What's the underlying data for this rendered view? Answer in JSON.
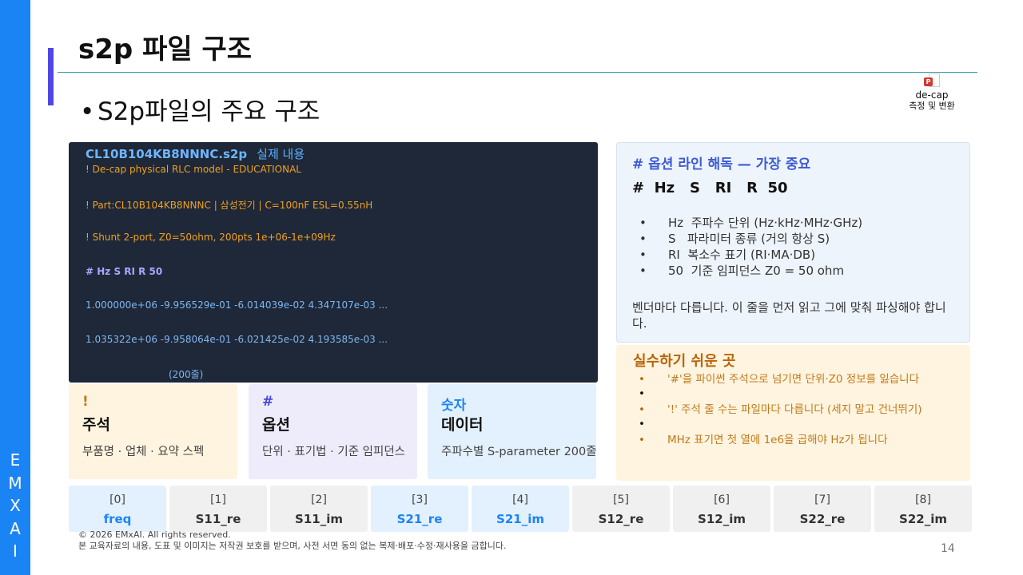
{
  "brand": {
    "letters": [
      "E",
      "M",
      "X",
      "A",
      "I"
    ],
    "color": "#1b84f5"
  },
  "title": "s2p 파일 구조",
  "bullet": "S2p파일의 주요 구조",
  "deck_icon": {
    "name": "de-cap",
    "sub": "측정 및 변환"
  },
  "code": {
    "filename": "CL10B104KB8NNNC.s2p",
    "caption": "실제 내용",
    "lines": {
      "c1": "! De-cap physical RLC model - EDUCATIONAL",
      "c2": "! Part:CL10B104KB8NNNC | 삼성전기 | C=100nF ESL=0.55nH",
      "c3": "! Shunt 2-port, Z0=50ohm, 200pts 1e+06-1e+09Hz",
      "opt": "# Hz S RI R 50",
      "d1": "1.000000e+06 -9.956529e-01 -6.014039e-02 4.347107e-03 ...",
      "d2": "1.035322e+06 -9.958064e-01 -6.021425e-02 4.193585e-03 ...",
      "count": "(200줄)"
    }
  },
  "options": {
    "title": "# 옵션 라인 해독 — 가장 중요",
    "line": "#  Hz   S   RI   R  50",
    "items": [
      {
        "key": "Hz",
        "text": "주파수 단위 (Hz·kHz·MHz·GHz)"
      },
      {
        "key": "S",
        "text": "파라미터 종류 (거의 항상 S)"
      },
      {
        "key": "RI",
        "text": "복소수 표기 (RI·MA·DB)"
      },
      {
        "key": "50",
        "text": "기준 임피던스 Z0 = 50 ohm"
      }
    ],
    "note": "벤더마다 다릅니다. 이 줄을 먼저 읽고 그에 맞춰 파싱해야 합니다."
  },
  "warnings": {
    "title": "실수하기 쉬운 곳",
    "items": [
      "'#'을 파이썬 주석으로 넘기면 단위·Z0 정보를 잃습니다",
      "",
      "'!' 주석 줄 수는 파일마다 다릅니다 (세지 말고 건너뛰기)",
      "",
      "MHz 표기면 첫 열에 1e6을 곱해야 Hz가 됩니다"
    ]
  },
  "cards": [
    {
      "symbol": "!",
      "label": "주석",
      "desc": "부품명 · 업체 · 요약 스펙"
    },
    {
      "symbol": "#",
      "label": "옵션",
      "desc": "단위 · 표기법 · 기준 임피던스"
    },
    {
      "symbol": "숫자",
      "label": "데이터",
      "desc": "주파수별 S-parameter 200줄"
    }
  ],
  "columns": [
    {
      "index": "[0]",
      "name": "freq",
      "highlight": true
    },
    {
      "index": "[1]",
      "name": "S11_re",
      "highlight": false
    },
    {
      "index": "[2]",
      "name": "S11_im",
      "highlight": false
    },
    {
      "index": "[3]",
      "name": "S21_re",
      "highlight": true
    },
    {
      "index": "[4]",
      "name": "S21_im",
      "highlight": true
    },
    {
      "index": "[5]",
      "name": "S12_re",
      "highlight": false
    },
    {
      "index": "[6]",
      "name": "S12_im",
      "highlight": false
    },
    {
      "index": "[7]",
      "name": "S22_re",
      "highlight": false
    },
    {
      "index": "[8]",
      "name": "S22_im",
      "highlight": false
    }
  ],
  "footer": {
    "copyright": "© 2026 EMxAI. All rights reserved.",
    "notice": "본 교육자료의 내용, 도표 및 이미지는 저작권 보호를 받으며, 사전 서면 동의 없는 복제·배포·수정·재사용을 금합니다.",
    "page": "14"
  }
}
